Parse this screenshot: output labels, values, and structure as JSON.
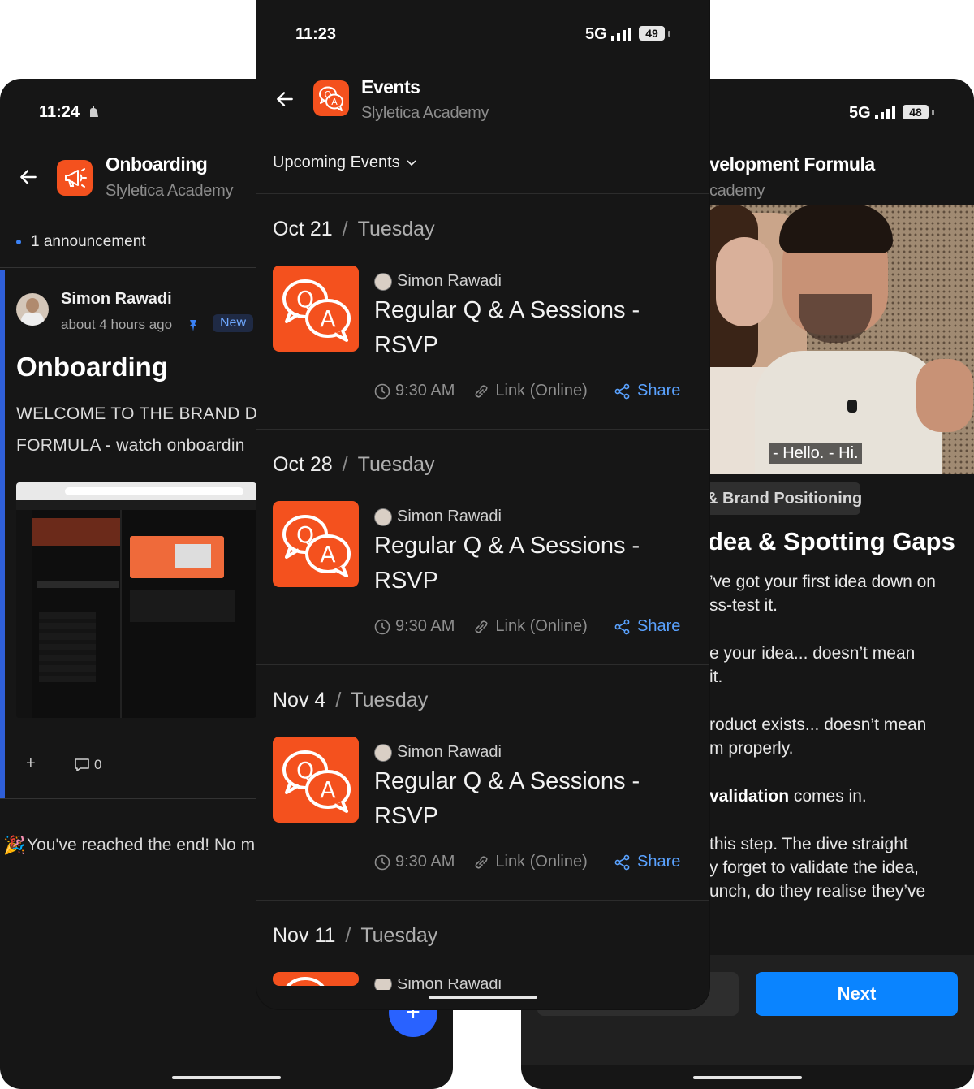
{
  "left": {
    "status_time": "11:24",
    "header_title": "Onboarding",
    "header_subtitle": "Slyletica Academy",
    "announcement": "1 announcement",
    "post": {
      "author": "Simon Rawadi",
      "time": "about 4 hours ago",
      "badge": "New",
      "title": "Onboarding",
      "body_line1": "WELCOME TO THE BRAND DI",
      "body_line2": "FORMULA - watch onboardin",
      "comment_count": "0"
    },
    "end_message": "You've reached the end! No mor",
    "fab_label": "+"
  },
  "center": {
    "status_time": "11:23",
    "status_network": "5G",
    "status_battery": "49",
    "header_title": "Events",
    "header_subtitle": "Slyletica Academy",
    "filter_label": "Upcoming Events",
    "events": [
      {
        "date": "Oct 21",
        "dow": "Tuesday",
        "host": "Simon Rawadi",
        "title": "Regular Q & A Sessions - RSVP",
        "time": "9:30 AM",
        "location": "Link (Online)",
        "share": "Share"
      },
      {
        "date": "Oct 28",
        "dow": "Tuesday",
        "host": "Simon Rawadi",
        "title": "Regular Q & A Sessions - RSVP",
        "time": "9:30 AM",
        "location": "Link (Online)",
        "share": "Share"
      },
      {
        "date": "Nov 4",
        "dow": "Tuesday",
        "host": "Simon Rawadi",
        "title": "Regular Q & A Sessions - RSVP",
        "time": "9:30 AM",
        "location": "Link (Online)",
        "share": "Share"
      },
      {
        "date": "Nov 11",
        "dow": "Tuesday",
        "host": "Simon Rawadi"
      }
    ]
  },
  "right": {
    "status_network": "5G",
    "status_battery": "48",
    "header_title": "velopment Formula",
    "header_subtitle": "cademy",
    "video_caption": "- Hello. - Hi.",
    "tag": "& Brand Positioning",
    "lesson_title": "dea & Spotting Gaps",
    "p1_line1": "’ve got your first idea down on",
    "p1_line2": "ss-test it.",
    "p2_line1": "e your idea... doesn’t mean",
    "p2_line2": "it.",
    "p3_line1": "roduct exists... doesn’t mean",
    "p3_line2": "m properly.",
    "p4_bold": "validation",
    "p4_rest": " comes in.",
    "p5_line1": "this step. The dive straight",
    "p5_line2": "y forget to validate the idea,",
    "p5_line3": "unch, do they realise they’ve",
    "next_button": "Next"
  }
}
